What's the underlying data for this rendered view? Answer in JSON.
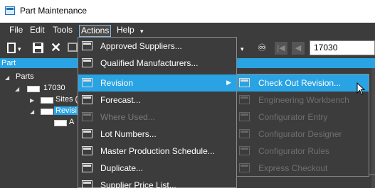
{
  "window": {
    "title": "Part Maintenance"
  },
  "menubar": {
    "items": [
      "File",
      "Edit",
      "Tools",
      "Actions",
      "Help"
    ],
    "help_caret": "▾"
  },
  "toolbar": {
    "part_number": "17030",
    "first_icon": "first-record-icon",
    "prev_icon": "previous-record-icon"
  },
  "panel": {
    "header": "Part"
  },
  "tree": {
    "root": "Parts",
    "part": "17030",
    "sites": "Sites (",
    "revisions": "Revisi",
    "revision_a": "A"
  },
  "actions_menu": {
    "items": [
      {
        "label": "Approved Suppliers...",
        "enabled": true,
        "icon": "window-icon"
      },
      {
        "label": "Qualified Manufacturers...",
        "enabled": true,
        "icon": "window-icon"
      },
      {
        "label": "Revision",
        "enabled": true,
        "icon": "window-icon",
        "submenu": true,
        "highlighted": true
      },
      {
        "label": "Forecast...",
        "enabled": true,
        "icon": "window-icon"
      },
      {
        "label": "Where Used...",
        "enabled": false,
        "icon": "window-icon"
      },
      {
        "label": "Lot Numbers...",
        "enabled": true,
        "icon": "window-icon"
      },
      {
        "label": "Master Production Schedule...",
        "enabled": true,
        "icon": "window-icon"
      },
      {
        "label": "Duplicate...",
        "enabled": true,
        "icon": "copy-icon"
      },
      {
        "label": "Supplier Price List...",
        "enabled": true,
        "icon": "window-icon"
      }
    ]
  },
  "revision_submenu": {
    "items": [
      {
        "label": "Check Out Revision...",
        "enabled": true,
        "highlighted": true
      },
      {
        "label": "Engineering Workbench",
        "enabled": false
      },
      {
        "label": "Configurator Entry",
        "enabled": false
      },
      {
        "label": "Configurator Designer",
        "enabled": false
      },
      {
        "label": "Configurator Rules",
        "enabled": false
      },
      {
        "label": "Express Checkout",
        "enabled": false
      }
    ]
  },
  "colors": {
    "accent": "#29a3e3",
    "background": "#3c3c3c",
    "disabled_text": "#7a7a7a"
  }
}
